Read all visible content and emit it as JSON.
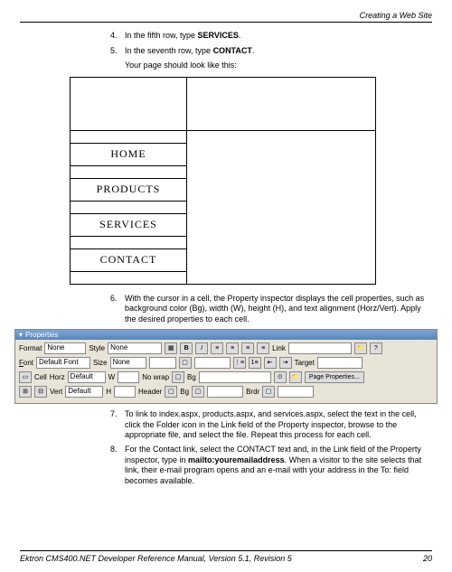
{
  "header": {
    "title": "Creating a Web Site"
  },
  "steps_top": [
    {
      "num": "4.",
      "pre": "In the fifth row, type ",
      "bold": "SERVICES",
      "post": "."
    },
    {
      "num": "5.",
      "pre": "In the seventh row, type ",
      "bold": "CONTACT",
      "post": "."
    }
  ],
  "steps_top_sub": "Your page should look like this:",
  "nav": [
    "HOME",
    "PRODUCTS",
    "SERVICES",
    "CONTACT"
  ],
  "steps_mid": [
    {
      "num": "6.",
      "text": "With the cursor in a cell, the Property inspector displays the cell properties, such as background color (Bg), width (W), height (H), and text alignment (Horz/Vert). Apply the desired properties to each cell."
    }
  ],
  "props": {
    "title": "Properties",
    "format_label": "Format",
    "format_value": "None",
    "style_label": "Style",
    "style_value": "None",
    "link_label": "Link",
    "font_label": "Font",
    "font_value": "Default Font",
    "size_label": "Size",
    "size_value": "None",
    "target_label": "Target",
    "cell_label": "Cell",
    "horz_label": "Horz",
    "horz_value": "Default",
    "vert_label": "Vert",
    "vert_value": "Default",
    "w_label": "W",
    "h_label": "H",
    "nowrap_label": "No wrap",
    "header_label": "Header",
    "bg_label": "Bg",
    "brdr_label": "Brdr",
    "page_props": "Page Properties..."
  },
  "steps_bot": [
    {
      "num": "7.",
      "text": "To link to index.aspx, products.aspx, and services.aspx, select the text in the cell, click the Folder icon in the Link field of the Property inspector, browse to the appropriate file, and select the file. Repeat this process for each cell."
    },
    {
      "num": "8.",
      "pre": "For the Contact link, select the CONTACT text and, in the Link field of the Property inspector, type in ",
      "bold": "mailto:youremailaddress",
      "post": ". When a visitor to the site selects that link, their e-mail program opens and an e-mail with your address in the To: field becomes available."
    }
  ],
  "footer": {
    "left": "Ektron CMS400.NET Developer Reference Manual, Version 5.1, Revision 5",
    "right": "20"
  }
}
